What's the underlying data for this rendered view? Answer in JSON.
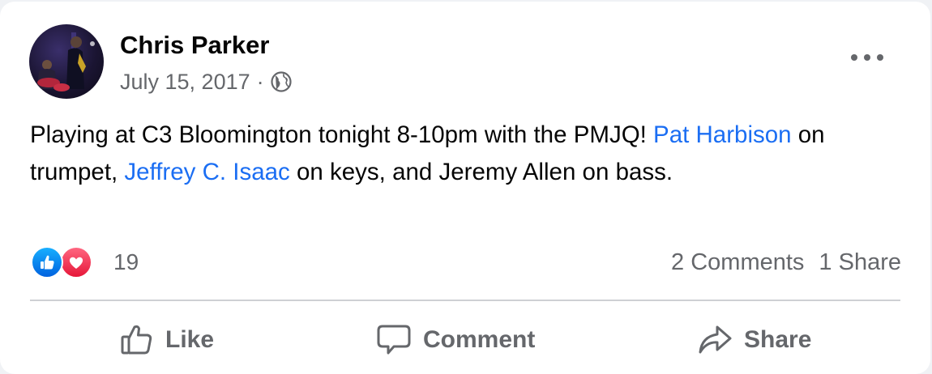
{
  "post": {
    "author": "Chris Parker",
    "date": "July 15, 2017",
    "separator": "·",
    "privacy_icon": "globe-icon",
    "text_parts": [
      {
        "text": "Playing at C3 Bloomington tonight 8-10pm with the PMJQ! "
      },
      {
        "text": "Pat Harbison",
        "mention": true
      },
      {
        "text": " on trumpet, "
      },
      {
        "text": "Jeffrey C. Isaac",
        "mention": true
      },
      {
        "text": " on keys, and Jeremy Allen on bass."
      }
    ]
  },
  "reactions": {
    "icons": [
      "like-reaction-icon",
      "love-reaction-icon"
    ],
    "count": "19"
  },
  "stats": {
    "comments": "2 Comments",
    "shares": "1 Share"
  },
  "actions": {
    "like": "Like",
    "comment": "Comment",
    "share": "Share"
  },
  "colors": {
    "mention": "#1b6ef3",
    "secondary_text": "#65676b",
    "like_blue": "#1877f2",
    "love_red": "#f33e58"
  }
}
